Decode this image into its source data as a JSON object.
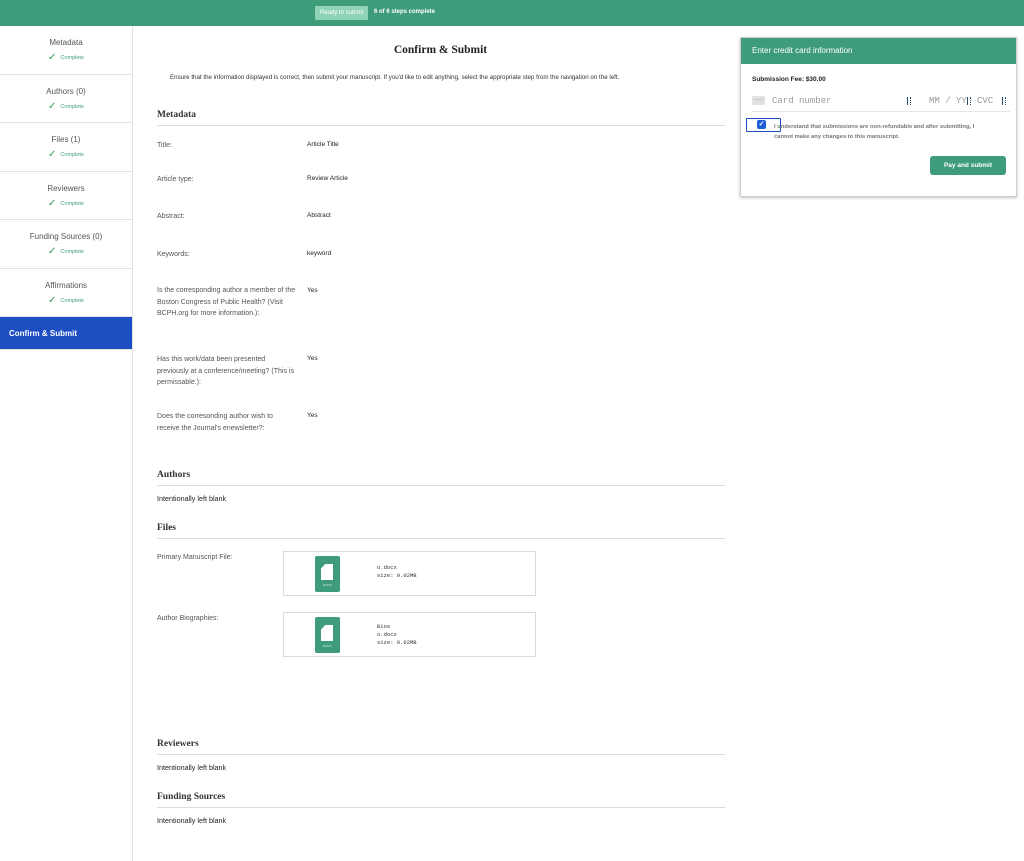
{
  "topbar": {
    "ready_label": "Ready to submit",
    "steps_text": "6 of 6  steps complete"
  },
  "sidebar": {
    "items": [
      {
        "label": "Metadata",
        "status": "Complete"
      },
      {
        "label": "Authors (0)",
        "status": "Complete"
      },
      {
        "label": "Files (1)",
        "status": "Complete"
      },
      {
        "label": "Reviewers",
        "status": "Complete"
      },
      {
        "label": "Funding Sources (0)",
        "status": "Complete"
      },
      {
        "label": "Affirmations",
        "status": "Complete"
      },
      {
        "label": "Confirm & Submit",
        "status": ""
      }
    ]
  },
  "main": {
    "title": "Confirm & Submit",
    "intro": "Ensure that the information displayed is correct, then submit your manuscript. If you'd like to edit anything, select the appropriate step from the navigation on the left.",
    "metadata": {
      "heading": "Metadata",
      "fields": [
        {
          "label": "Title:",
          "value": "Article Title"
        },
        {
          "label": "Article type:",
          "value": "Review Article"
        },
        {
          "label": "Abstract:",
          "value": "Abstract"
        },
        {
          "label": "Keywords:",
          "value": "keyword"
        },
        {
          "label": "Is the corresponding author a member of the Boston Congress of Public Health? (Visit BCPH.org for more information.):",
          "value": "Yes"
        },
        {
          "label": "Has this work/data been presented previously at a conference/meeting? (This is permissable.):",
          "value": "Yes"
        },
        {
          "label": "Does the corresonding author wish to receive the Journal's enewsletter?:",
          "value": "Yes"
        }
      ]
    },
    "authors": {
      "heading": "Authors",
      "text": "Intentionally left blank"
    },
    "files": {
      "heading": "Files",
      "items": [
        {
          "label": "Primary Manuscript File:",
          "ext": "DOCX",
          "lines": [
            "o.docx",
            "size: 0.02MB"
          ]
        },
        {
          "label": "Author Biographies:",
          "ext": "DOCX",
          "lines": [
            "Bios",
            "o.docx",
            "size: 0.02MB"
          ]
        }
      ]
    },
    "reviewers": {
      "heading": "Reviewers",
      "text": "Intentionally left blank"
    },
    "funding": {
      "heading": "Funding Sources",
      "text": "Intentionally left blank"
    }
  },
  "payment": {
    "header": "Enter credit card information",
    "fee": "Submission Fee: $30.00",
    "card_placeholder": "Card number",
    "expiry_placeholder": "MM / YY",
    "cvc_placeholder": "CVC",
    "agree_checked": true,
    "agree_text": "I understand that submissions are non-refundable and after submitting, I cannot make any changes to this manuscript.",
    "button": "Pay and submit"
  }
}
